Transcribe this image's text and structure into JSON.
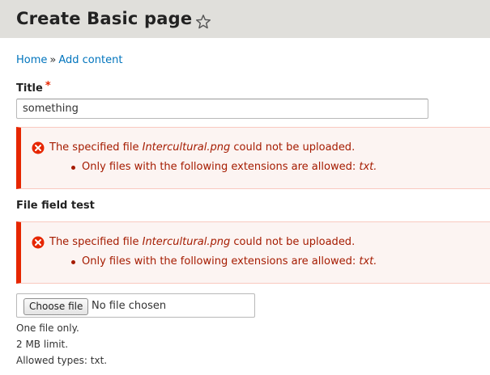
{
  "header": {
    "title": "Create Basic page"
  },
  "breadcrumb": {
    "home": "Home",
    "separator": "»",
    "add_content": "Add content"
  },
  "title_field": {
    "label": "Title",
    "required_marker": "*",
    "value": "something"
  },
  "errors": [
    {
      "prefix": "The specified file ",
      "filename": "Intercultural.png",
      "suffix": " could not be uploaded.",
      "detail_prefix": "Only files with the following extensions are allowed: ",
      "detail_ext": "txt."
    },
    {
      "prefix": "The specified file ",
      "filename": "Intercultural.png",
      "suffix": " could not be uploaded.",
      "detail_prefix": "Only files with the following extensions are allowed: ",
      "detail_ext": "txt."
    }
  ],
  "file_field": {
    "label": "File field test",
    "button_label": "Choose file",
    "status": "No file chosen",
    "help": [
      "One file only.",
      "2 MB limit.",
      "Allowed types: txt."
    ]
  },
  "colors": {
    "header_bg": "#e0dfdb",
    "link": "#0074bd",
    "error_text": "#a51b00",
    "error_border": "#e62600",
    "error_bg": "#fcf4f2"
  },
  "icons": {
    "favorite": "star-outline-icon",
    "error": "error-circle-x-icon"
  }
}
